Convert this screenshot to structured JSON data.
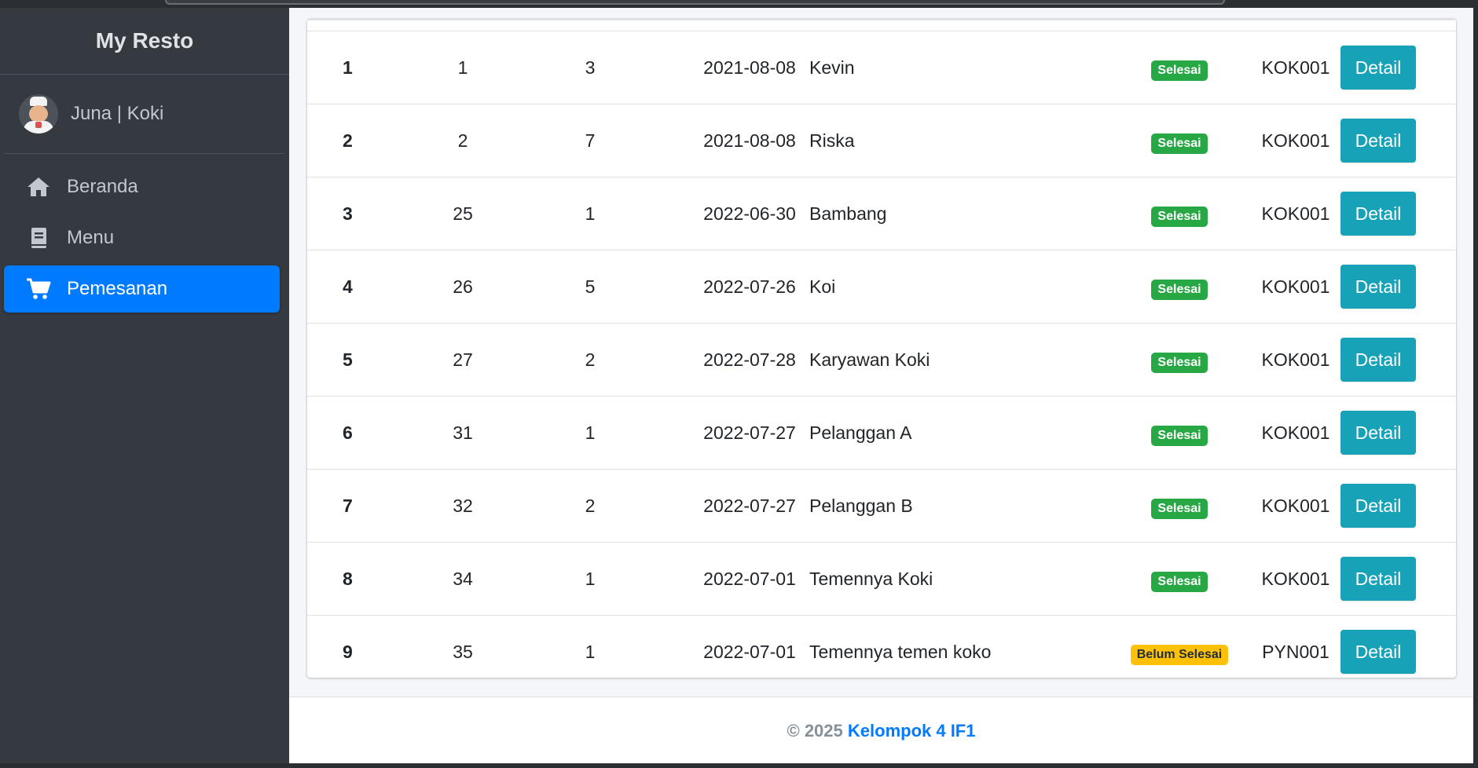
{
  "sidebar": {
    "brand": "My Resto",
    "user": {
      "name": "Juna | Koki"
    },
    "items": [
      {
        "label": "Beranda",
        "icon": "home-icon"
      },
      {
        "label": "Menu",
        "icon": "book-icon"
      },
      {
        "label": "Pemesanan",
        "icon": "cart-icon",
        "active": true
      }
    ]
  },
  "table": {
    "detail_label": "Detail",
    "rows": [
      {
        "no": "1",
        "id": "1",
        "meja": "3",
        "tanggal": "2021-08-08",
        "nama": "Kevin",
        "status": "Selesai",
        "koki": "KOK001"
      },
      {
        "no": "2",
        "id": "2",
        "meja": "7",
        "tanggal": "2021-08-08",
        "nama": "Riska",
        "status": "Selesai",
        "koki": "KOK001"
      },
      {
        "no": "3",
        "id": "25",
        "meja": "1",
        "tanggal": "2022-06-30",
        "nama": "Bambang",
        "status": "Selesai",
        "koki": "KOK001"
      },
      {
        "no": "4",
        "id": "26",
        "meja": "5",
        "tanggal": "2022-07-26",
        "nama": "Koi",
        "status": "Selesai",
        "koki": "KOK001"
      },
      {
        "no": "5",
        "id": "27",
        "meja": "2",
        "tanggal": "2022-07-28",
        "nama": "Karyawan Koki",
        "status": "Selesai",
        "koki": "KOK001"
      },
      {
        "no": "6",
        "id": "31",
        "meja": "1",
        "tanggal": "2022-07-27",
        "nama": "Pelanggan A",
        "status": "Selesai",
        "koki": "KOK001"
      },
      {
        "no": "7",
        "id": "32",
        "meja": "2",
        "tanggal": "2022-07-27",
        "nama": "Pelanggan B",
        "status": "Selesai",
        "koki": "KOK001"
      },
      {
        "no": "8",
        "id": "34",
        "meja": "1",
        "tanggal": "2022-07-01",
        "nama": "Temennya Koki",
        "status": "Selesai",
        "koki": "KOK001"
      },
      {
        "no": "9",
        "id": "35",
        "meja": "1",
        "tanggal": "2022-07-01",
        "nama": "Temennya temen koko",
        "status": "Belum Selesai",
        "koki": "PYN001"
      }
    ]
  },
  "footer": {
    "prefix": "© 2025",
    "link": "Kelompok 4 IF1"
  },
  "colors": {
    "sidebar": "#343a40",
    "active": "#007bff",
    "info": "#17a2b8",
    "success": "#28a745",
    "warning": "#ffc107"
  }
}
